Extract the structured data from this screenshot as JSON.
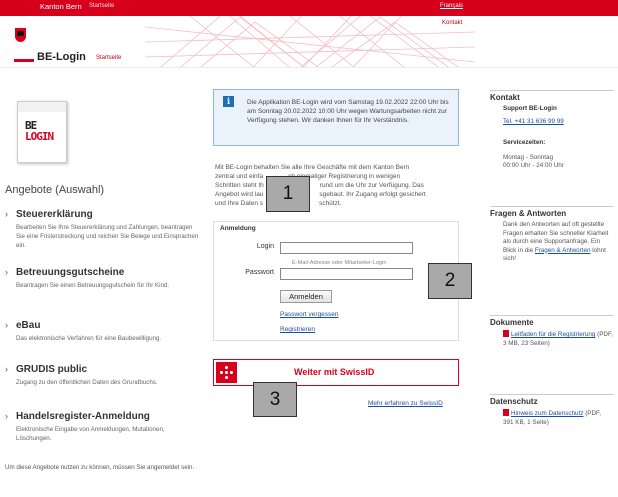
{
  "topbar": {
    "site_name": "Kanton Bern",
    "home": "Startseite",
    "language": "Français"
  },
  "header": {
    "contact": "Kontakt",
    "brand": "BE-Login",
    "brand_sub": "Startseite"
  },
  "logo": {
    "line1": "BE",
    "line2": "LOGIN"
  },
  "offers": {
    "title": "Angebote (Auswahl)",
    "items": [
      {
        "title": "Steuererklärung",
        "desc": "Bearbeiten Sie Ihre Steuererklärung und Zahlungen, beantragen Sie eine Fristerstreckung und reichen Sie Belege und Einsprachen ein."
      },
      {
        "title": "Betreuungsgutscheine",
        "desc": "Beantragen Sie einen Betreuungsgutschein für Ihr Kind."
      },
      {
        "title": "eBau",
        "desc": "Das elektronische Verfahren für eine Baubewilligung."
      },
      {
        "title": "GRUDIS public",
        "desc": "Zugang zu den öffentlichen Daten des Grundbuchs."
      },
      {
        "title": "Handelsregister-Anmeldung",
        "desc": "Elektronische Eingabe von Anmeldungen, Mutationen, Löschungen."
      }
    ],
    "note": "Um diese Angebote nutzen zu können, müssen Sie angemeldet sein."
  },
  "info_message": "Die Applikation BE-Login wird vom Samstag 19.02.2022 22:00 Uhr bis am Sonntag 20.02.2022 10:00 Uhr wegen Wartungsarbeiten nicht zur Verfügung stehen. Wir danken Ihnen für Ihr Verständnis.",
  "intro": {
    "line1": "Mit BE-Login behalten Sie alle Ihre Geschäfte mit dem Kanton Bern",
    "line2a": "zentral und einfa",
    "line2b": "ch einmaliger Registrierung in wenigen",
    "line3a": "Schritten steht Ih",
    "line3b": "rund um die Uhr zur Verfügung. Das",
    "line4a": "Angebot wird lau",
    "line4b": "sgebaut. Ihr Zugang erfolgt gesichert",
    "line5a": "und Ihre Daten s",
    "line5b": "schützt."
  },
  "login": {
    "heading": "Anmeldung",
    "login_label": "Login",
    "login_value": "",
    "login_hint": "E-Mail-Adresse oder Mitarbeiter-Login",
    "password_label": "Passwort",
    "password_value": "",
    "submit": "Anmelden",
    "forgot": "Passwort vergessen",
    "register": "Registrieren"
  },
  "swissid": {
    "label": "Weiter mit SwissID",
    "more": "Mehr erfahren zu SwissID"
  },
  "sidebar": {
    "contact": {
      "title": "Kontakt",
      "support": "Support BE-Login",
      "phone": "Tel. +41 31 636 99 99",
      "service_title": "Servicezeiten:",
      "service_days": "Montag - Sonntag",
      "service_hours": "00:00 Uhr - 24:00 Uhr"
    },
    "faq": {
      "title": "Fragen & Antworten",
      "text": "Dank den Antworten auf oft gestellte Fragen erhalten Sie schneller Klarheit als durch eine Supportanfrage. Ein Blick in die",
      "link": "Fragen & Antworten",
      "suffix": "lohnt sich!"
    },
    "documents": {
      "title": "Dokumente",
      "link": "Leitfaden für die Registrierung",
      "meta": "(PDF, 3 MB, 23 Seiten)"
    },
    "privacy": {
      "title": "Datenschutz",
      "link": "Hinweis zum Datenschutz",
      "meta": "(PDF, 391 KB, 1 Seite)"
    }
  },
  "markers": [
    "1",
    "2",
    "3"
  ]
}
